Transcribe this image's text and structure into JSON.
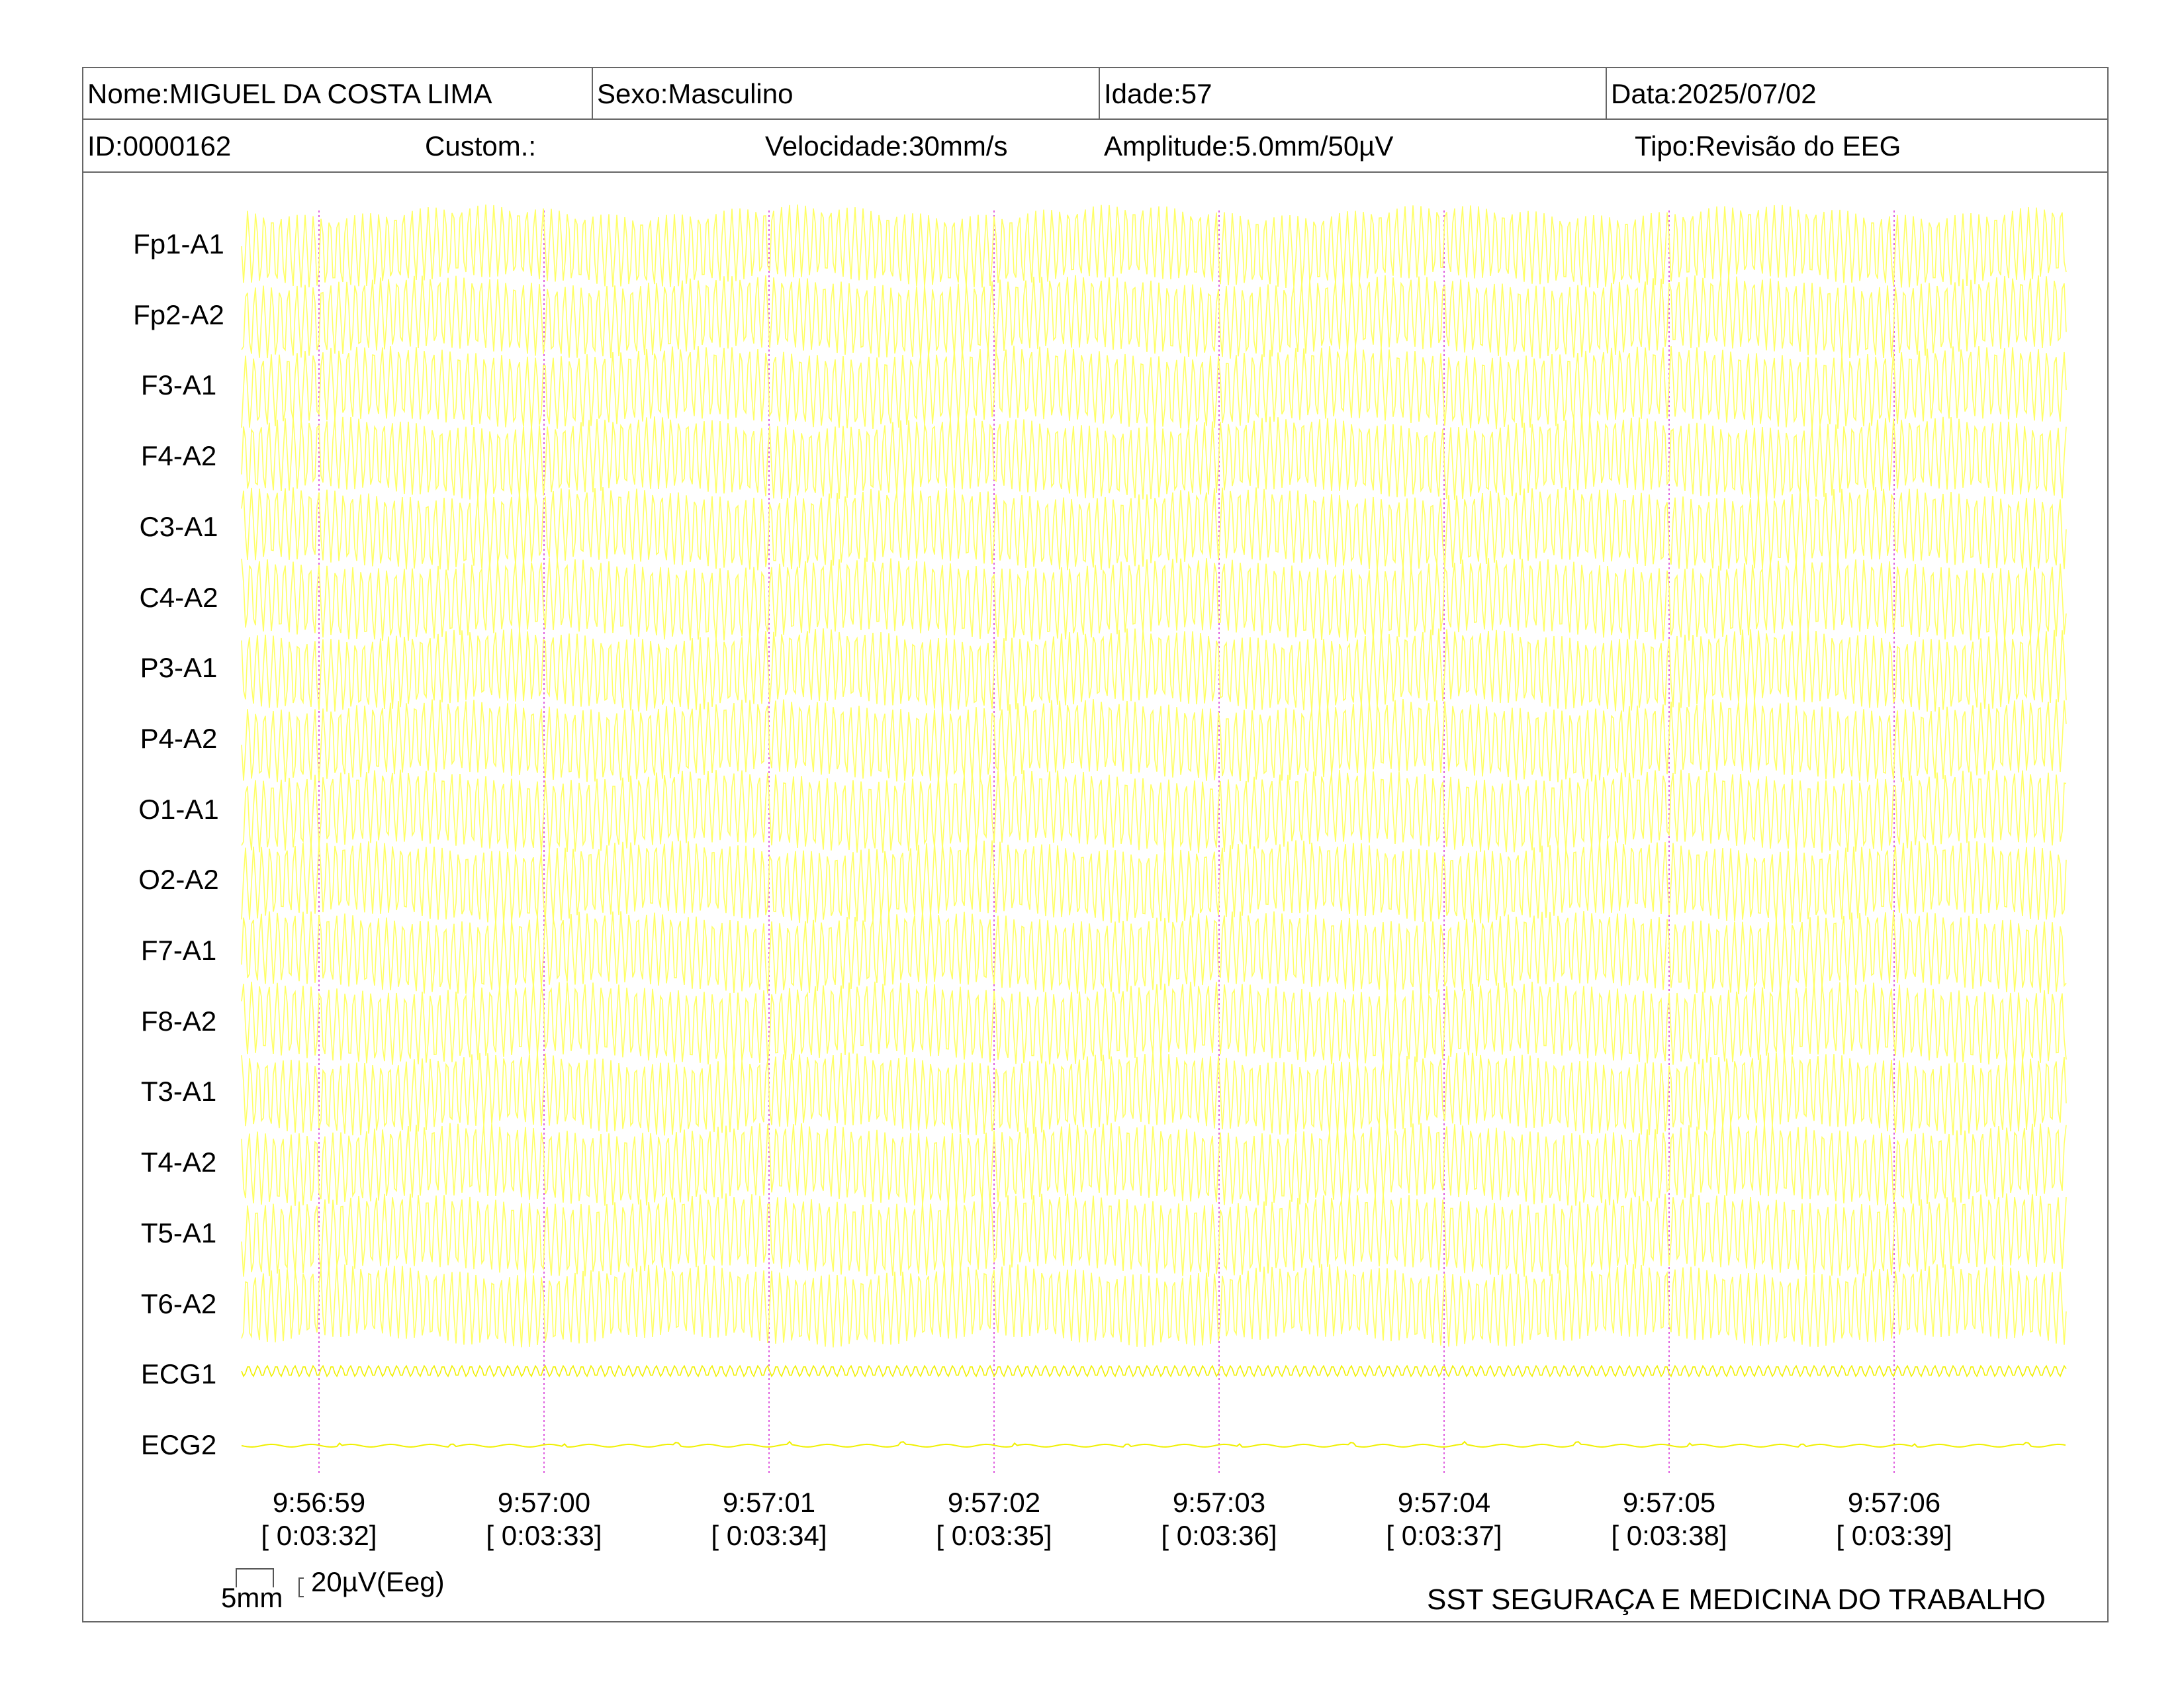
{
  "header": {
    "nome": "Nome:MIGUEL DA COSTA LIMA",
    "sexo": "Sexo:Masculino",
    "idade": "Idade:57",
    "data": "Data:2025/07/02",
    "id": "ID:0000162",
    "custom": "Custom.:",
    "velocidade": "Velocidade:30mm/s",
    "amplitude": "Amplitude:5.0mm/50µV",
    "tipo": "Tipo:Revisão do EEG"
  },
  "channels": [
    "Fp1-A1",
    "Fp2-A2",
    "F3-A1",
    "F4-A2",
    "C3-A1",
    "C4-A2",
    "P3-A1",
    "P4-A2",
    "O1-A1",
    "O2-A2",
    "F7-A1",
    "F8-A2",
    "T3-A1",
    "T4-A2",
    "T5-A1",
    "T6-A2",
    "ECG1",
    "ECG2"
  ],
  "time_marks": [
    {
      "clock": "9:56:59",
      "elapsed": "[ 0:03:32]"
    },
    {
      "clock": "9:57:00",
      "elapsed": "[ 0:03:33]"
    },
    {
      "clock": "9:57:01",
      "elapsed": "[ 0:03:34]"
    },
    {
      "clock": "9:57:02",
      "elapsed": "[ 0:03:35]"
    },
    {
      "clock": "9:57:03",
      "elapsed": "[ 0:03:36]"
    },
    {
      "clock": "9:57:04",
      "elapsed": "[ 0:03:37]"
    },
    {
      "clock": "9:57:05",
      "elapsed": "[ 0:03:38]"
    },
    {
      "clock": "9:57:06",
      "elapsed": "[ 0:03:39]"
    }
  ],
  "scale": {
    "time": "5mm",
    "amplitude": "20µV(Eeg)"
  },
  "footer": "SST SEGURAÇA E MEDICINA DO TRABALHO",
  "colors": {
    "trace": "#ffff66",
    "trace_strong": "#f0f000",
    "marker": "#e060e0",
    "border": "#666666"
  }
}
